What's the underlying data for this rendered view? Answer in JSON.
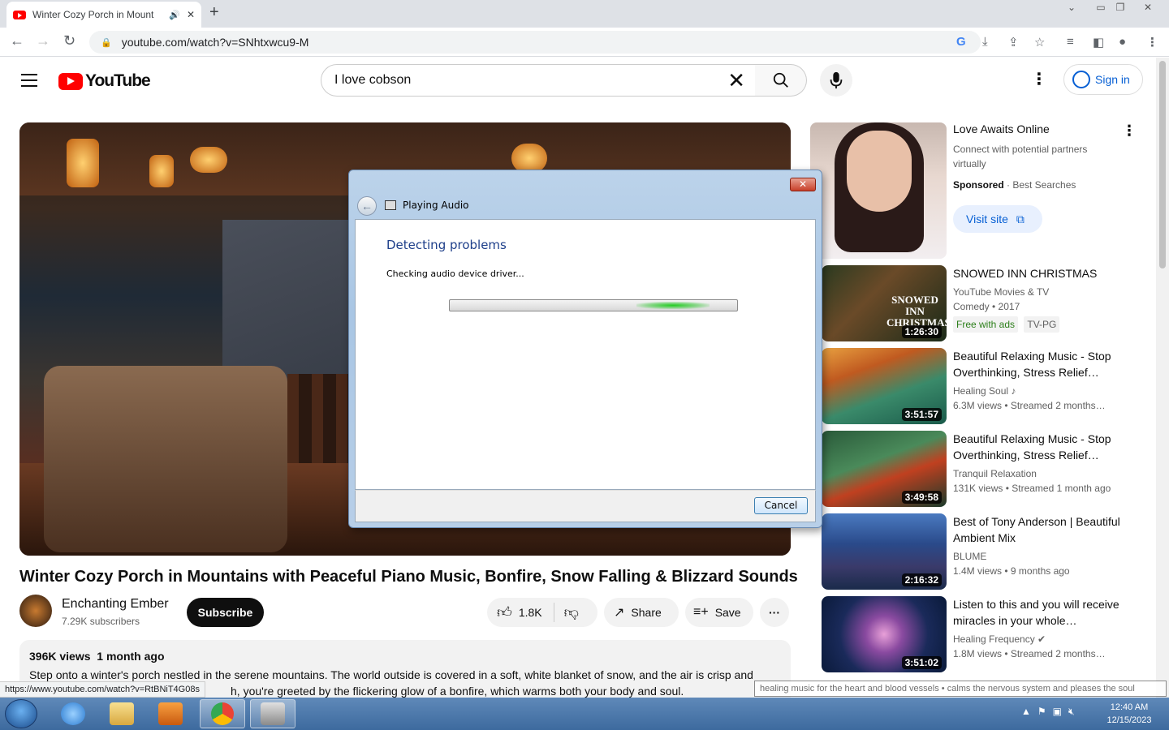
{
  "browser": {
    "tab_title": "Winter Cozy Porch in Mount",
    "tab_close": "✕",
    "new_tab": "+",
    "url": "youtube.com/watch?v=SNhtxwcu9-M"
  },
  "youtube": {
    "logo_text": "YouTube",
    "search_value": "I love cobson",
    "sign_in": "Sign in"
  },
  "video": {
    "title": "Winter Cozy Porch in Mountains with Peaceful Piano Music, Bonfire, Snow Falling & Blizzard Sounds",
    "channel": "Enchanting Ember",
    "subscribers": "7.29K subscribers",
    "subscribe_label": "Subscribe",
    "likes": "1.8K",
    "share_label": "Share",
    "save_label": "Save",
    "stats": "396K views  1 month ago",
    "description_line1": "Step onto a winter's porch nestled in the serene mountains. The world outside is covered in a soft, white blanket of snow, and the air is crisp and",
    "description_line2": "h, you're greeted by the flickering glow of a bonfire, which warms both your body and soul."
  },
  "ad": {
    "title": "Love Awaits Online",
    "subtitle": "Connect with potential partners virtually",
    "sponsored": "Sponsored",
    "advertiser": " · Best Searches",
    "visit_label": "Visit site"
  },
  "sidebar": [
    {
      "title": "SNOWED INN CHRISTMAS",
      "line1": "YouTube Movies & TV",
      "line2": "Comedy • 2017",
      "badge1": "Free with ads",
      "badge2": "TV-PG",
      "duration": "1:26:30",
      "thumb_text": "SNOWED INN CHRISTMAS"
    },
    {
      "title": "Beautiful Relaxing Music - Stop Overthinking, Stress Relief…",
      "line1": "Healing Soul ♪",
      "line2": "6.3M views  • Streamed 2 months…",
      "duration": "3:51:57"
    },
    {
      "title": "Beautiful Relaxing Music - Stop Overthinking, Stress Relief…",
      "line1": "Tranquil Relaxation",
      "line2": "131K views  • Streamed 1 month ago",
      "duration": "3:49:58"
    },
    {
      "title": "Best of Tony Anderson | Beautiful Ambient Mix",
      "line1": "BLUME",
      "line2": "1.4M views  • 9 months ago",
      "duration": "2:16:32"
    },
    {
      "title": "Listen to this and you will receive miracles in your whole…",
      "line1": "Healing Frequency ✔",
      "line2": "1.8M views  • Streamed 2 months…",
      "duration": "3:51:02"
    }
  ],
  "dialog": {
    "title": "Playing Audio",
    "heading": "Detecting problems",
    "message": "Checking audio device driver...",
    "cancel_label": "Cancel",
    "close_symbol": "✕"
  },
  "status_url": "https://www.youtube.com/watch?v=RtBNiT4G08s",
  "tooltip": "healing music for the heart and blood vessels • calms the nervous system and pleases the soul",
  "taskbar": {
    "time": "12:40 AM",
    "date": "12/15/2023"
  }
}
